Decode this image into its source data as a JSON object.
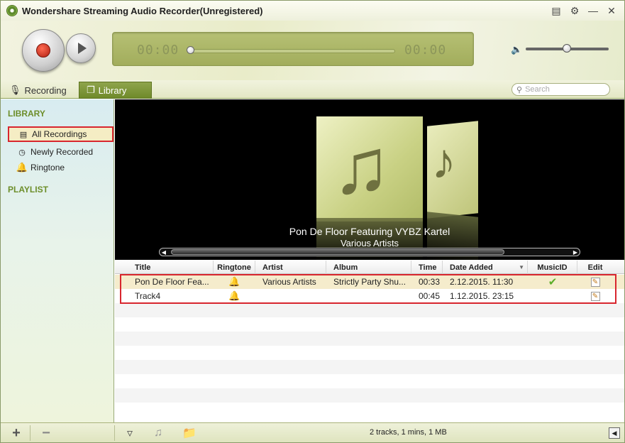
{
  "window": {
    "title": "Wondershare Streaming Audio Recorder(Unregistered)"
  },
  "player": {
    "elapsed": "00:00",
    "remaining": "00:00",
    "progress": 0,
    "volume": 0.47
  },
  "tabs": [
    {
      "label": "Recording"
    },
    {
      "label": "Library"
    }
  ],
  "search": {
    "placeholder": "Search"
  },
  "sidebar": {
    "library_heading": "LIBRARY",
    "items": [
      {
        "label": "All Recordings"
      },
      {
        "label": "Newly Recorded"
      },
      {
        "label": "Ringtone"
      }
    ],
    "playlist_heading": "PLAYLIST"
  },
  "coverflow": {
    "title": "Pon De Floor Featuring VYBZ Kartel",
    "artist": "Various Artists"
  },
  "table": {
    "columns": [
      "Title",
      "Ringtone",
      "Artist",
      "Album",
      "Time",
      "Date Added",
      "MusicID",
      "Edit"
    ],
    "rows": [
      {
        "title": "Pon De Floor Fea...",
        "artist": "Various Artists",
        "album": "Strictly Party Shu...",
        "time": "00:33",
        "date": "2.12.2015. 11:30",
        "musicid": true
      },
      {
        "title": "Track4",
        "artist": "",
        "album": "",
        "time": "00:45",
        "date": "1.12.2015. 23:15",
        "musicid": false
      }
    ]
  },
  "status": {
    "text": "2 tracks, 1 mins, 1 MB"
  },
  "colors": {
    "accent": "#6f8a2a",
    "highlight": "#d8262e",
    "selection": "#f5eccc"
  }
}
